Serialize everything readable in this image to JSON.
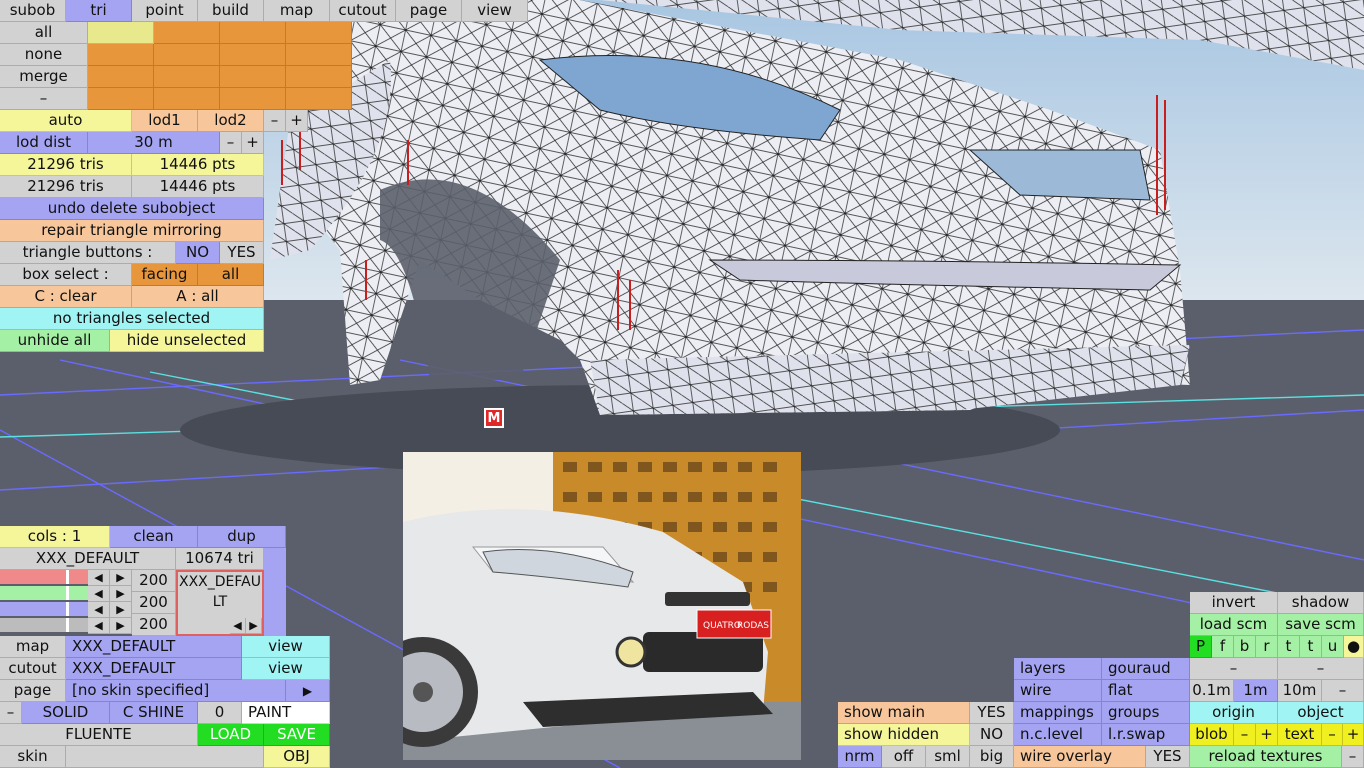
{
  "menu": [
    "subob",
    "tri",
    "point",
    "build",
    "map",
    "cutout",
    "page",
    "view"
  ],
  "subobj": {
    "rows": [
      "all",
      "none",
      "merge",
      "–"
    ]
  },
  "lod": {
    "auto": "auto",
    "lod1": "lod1",
    "lod2": "lod2",
    "minus": "–",
    "plus": "+",
    "dist_label": "lod dist",
    "dist_value": "30 m"
  },
  "counts": {
    "tris1": "21296 tris",
    "pts1": "14446 pts",
    "tris2": "21296 tris",
    "pts2": "14446 pts"
  },
  "actions": {
    "undo": "undo delete subobject",
    "repair": "repair triangle mirroring",
    "tri_buttons": "triangle buttons :",
    "no": "NO",
    "yes": "YES",
    "box_select": "box select :",
    "facing": "facing",
    "all": "all",
    "c_clear": "C : clear",
    "a_all": "A : all",
    "status": "no triangles selected",
    "unhide": "unhide all",
    "hide_unsel": "hide unselected"
  },
  "marker": "M",
  "material": {
    "cols": "cols : 1",
    "clean": "clean",
    "dup": "dup",
    "name": "XXX_DEFAULT",
    "tri_count": "10674 tri",
    "v1": "200",
    "v2": "200",
    "v3": "200",
    "preview_l1": "XXX_DEFAU",
    "preview_l2": "LT",
    "left": "◀",
    "right": "▶",
    "map_label": "map",
    "map_value": "XXX_DEFAULT",
    "view": "view",
    "cutout_label": "cutout",
    "cutout_value": "XXX_DEFAULT",
    "page_label": "page",
    "page_value": "[no skin specified]",
    "play": "▶",
    "minus": "–",
    "solid": "SOLID",
    "cshine": "C SHINE",
    "zero": "0",
    "paint": "PAINT",
    "fluente": "FLUENTE",
    "load": "LOAD",
    "save": "SAVE",
    "skin_label": "skin",
    "obj": "OBJ"
  },
  "photo": {
    "plate1": "QUATRO",
    "plate2": "RODAS"
  },
  "bottom": {
    "show_main": "show main",
    "yes": "YES",
    "show_hidden": "show hidden",
    "no": "NO",
    "nrm": "nrm",
    "off": "off",
    "sml": "sml",
    "big": "big",
    "layers": "layers",
    "gouraud": "gouraud",
    "wire": "wire",
    "flat": "flat",
    "mappings": "mappings",
    "groups": "groups",
    "nclevel": "n.c.level",
    "lrswap": "l.r.swap",
    "wire_overlay": "wire overlay",
    "wo_yes": "YES",
    "invert": "invert",
    "shadow": "shadow",
    "load_scm": "load scm",
    "save_scm": "save scm",
    "letters": [
      "P",
      "f",
      "b",
      "r",
      "t",
      "t",
      "u",
      "●"
    ],
    "dash1": "–",
    "dash2": "–",
    "g01": "0.1m",
    "g1": "1m",
    "g10": "10m",
    "gminus": "–",
    "origin": "origin",
    "object": "object",
    "blob": "blob",
    "bminus": "–",
    "bplus": "+",
    "text": "text",
    "tminus": "–",
    "tplus": "+",
    "reload": "reload textures",
    "rminus": "–"
  },
  "colors": {
    "sky_top": "#a9c7e0",
    "floor": "#5a5e6a",
    "grid_blue": "#6a6aff",
    "grid_cyan": "#5ae0e0"
  }
}
